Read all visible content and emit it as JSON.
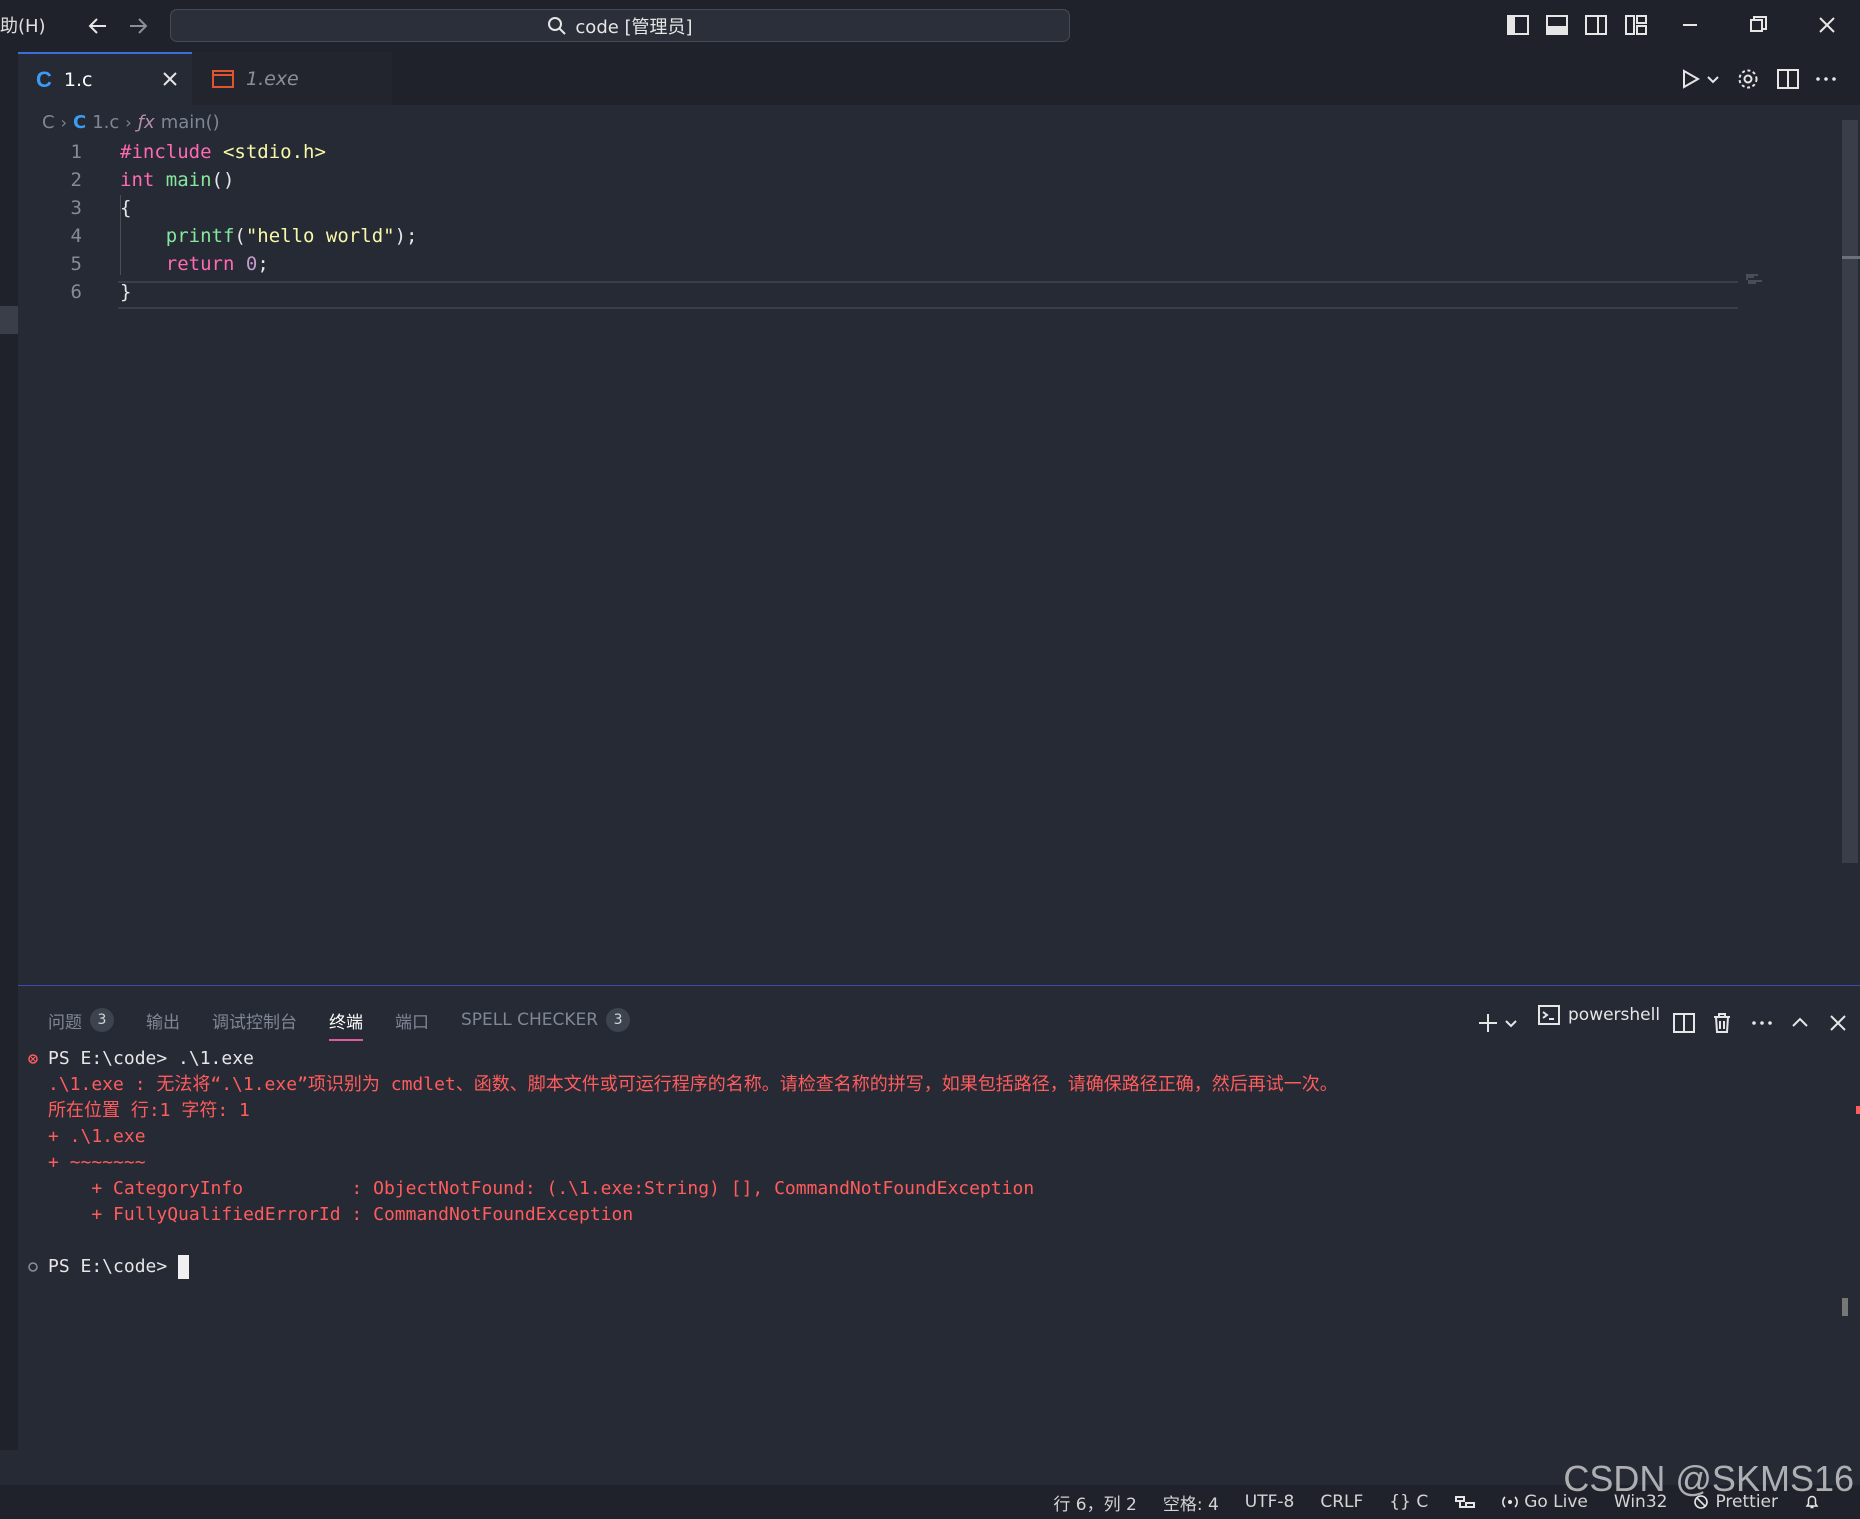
{
  "titlebar": {
    "menu_help": "助(H)",
    "search_text": "code [管理员]"
  },
  "tabs": [
    {
      "label": "1.c",
      "icon": "c-language-icon",
      "active": true
    },
    {
      "label": "1.exe",
      "icon": "binary-file-icon",
      "active": false
    }
  ],
  "breadcrumb": {
    "folder": "C",
    "file": "1.c",
    "symbol": "main()"
  },
  "editor": {
    "lines": [
      {
        "n": "1",
        "text": "#include <stdio.h>"
      },
      {
        "n": "2",
        "text": "int main()"
      },
      {
        "n": "3",
        "text": "{"
      },
      {
        "n": "4",
        "text": "    printf(\"hello world\");"
      },
      {
        "n": "5",
        "text": "    return 0;"
      },
      {
        "n": "6",
        "text": "}"
      }
    ],
    "current_line": 6
  },
  "panel": {
    "tabs": [
      {
        "label": "问题",
        "badge": "3"
      },
      {
        "label": "输出"
      },
      {
        "label": "调试控制台"
      },
      {
        "label": "终端",
        "active": true
      },
      {
        "label": "端口"
      },
      {
        "label": "SPELL CHECKER",
        "badge": "3"
      }
    ],
    "shell": "powershell"
  },
  "terminal": {
    "lines": [
      "PS E:\\code> .\\1.exe",
      ".\\1.exe : 无法将“.\\1.exe”项识别为 cmdlet、函数、脚本文件或可运行程序的名称。请检查名称的拼写，如果包括路径，请确保路径正确，然后再试一次。",
      "所在位置 行:1 字符: 1",
      "+ .\\1.exe",
      "+ ~~~~~~~",
      "    + CategoryInfo          : ObjectNotFound: (.\\1.exe:String) [], CommandNotFoundException",
      "    + FullyQualifiedErrorId : CommandNotFoundException",
      "",
      "PS E:\\code> "
    ]
  },
  "statusbar": {
    "position": "行 6，列 2",
    "spaces": "空格: 4",
    "encoding": "UTF-8",
    "eol": "CRLF",
    "language": "{} C",
    "go_live": "Go Live",
    "platform": "Win32",
    "prettier": "Prettier"
  },
  "watermark": "CSDN @SKMS16",
  "colors": {
    "background": "#262a35",
    "error_text": "#ff5c5c",
    "keyword": "#ff6ab3",
    "function": "#85e89d",
    "string": "#f8f8a8"
  }
}
